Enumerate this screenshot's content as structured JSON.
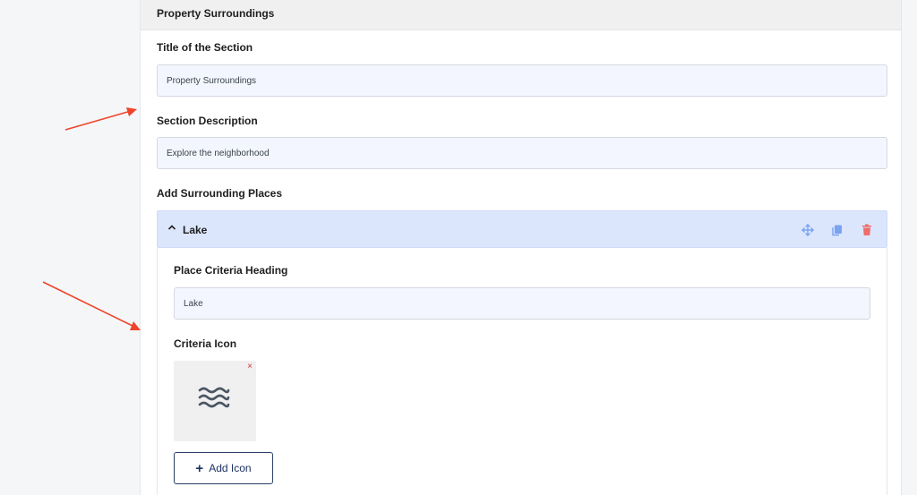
{
  "section": {
    "header": "Property Surroundings",
    "title_label": "Title of the Section",
    "title_value": "Property Surroundings",
    "description_label": "Section Description",
    "description_value": "Explore the neighborhood",
    "places_label": "Add Surrounding Places"
  },
  "repeater": {
    "item_title": "Lake",
    "icons": [
      "move-icon",
      "duplicate-icon",
      "trash-icon"
    ],
    "heading_label": "Place Criteria Heading",
    "heading_value": "Lake",
    "icon_label": "Criteria Icon",
    "icon_preview": "waves-icon",
    "remove_symbol": "×",
    "add_icon_plus": "+",
    "add_icon_label": "Add Icon"
  },
  "colors": {
    "accent": "#1d3264",
    "repeater_header": "#dbe6fd",
    "toolbar_icon": "#7aa3f0",
    "trash": "#f06c6c",
    "annotation_arrow": "#f0442a"
  }
}
